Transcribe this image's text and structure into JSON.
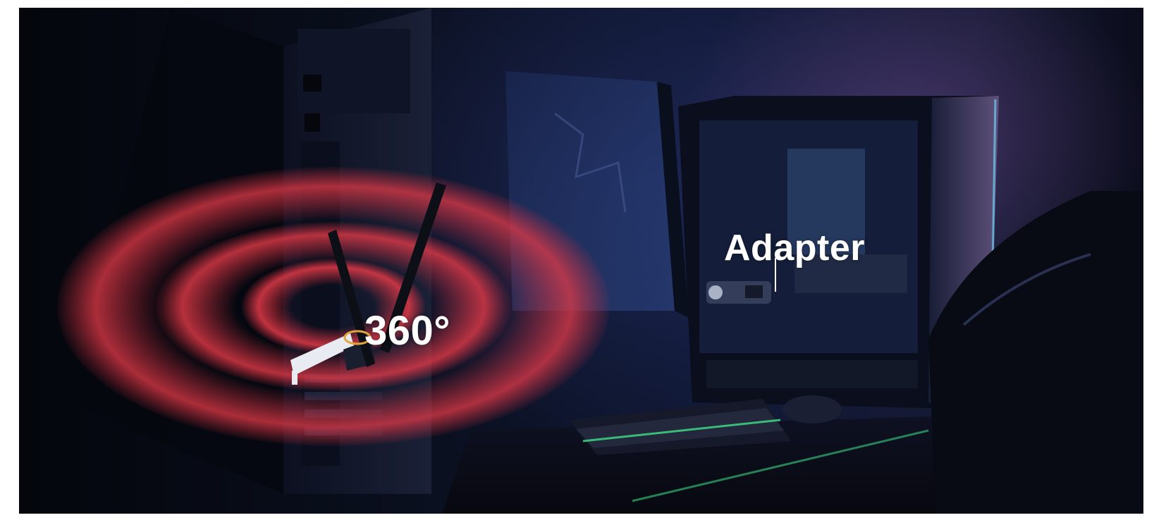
{
  "labels": {
    "rotation": "360°",
    "adapter": "Adapter"
  },
  "colors": {
    "signal_ring": "#e0303f",
    "background_dark": "#0a0f1e",
    "accent_purple": "#7a5096",
    "keyboard_glow": "#3fe08a"
  }
}
